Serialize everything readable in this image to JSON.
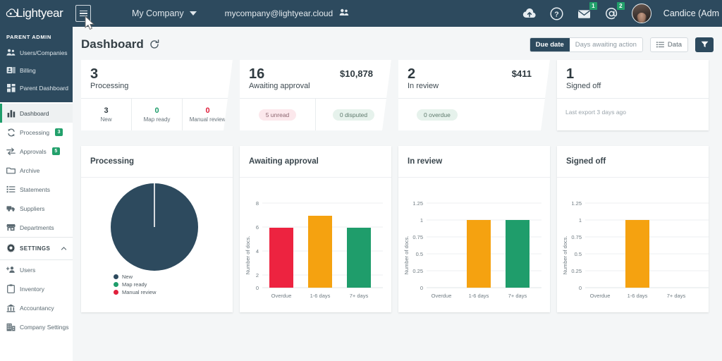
{
  "topbar": {
    "logo_text": "Lightyear",
    "logo_icon": "cloud-icon",
    "menu_toggle_icon": "hamburger-menu-icon",
    "company_selector": "My Company",
    "company_caret_icon": "chevron-down-icon",
    "tenant_domain": "mycompany@lightyear.cloud",
    "tenant_icon": "users-icon",
    "upload_icon": "cloud-upload-icon",
    "help_icon": "question-mark-icon",
    "mail_icon": "envelope-icon",
    "mail_badge": "1",
    "mentions_icon": "at-sign-icon",
    "mentions_badge": "2",
    "avatar_icon": "user-avatar",
    "user_name": "Candice (Adm"
  },
  "sidebar": {
    "section_title": "PARENT ADMIN",
    "admin_items": [
      {
        "label": "Users/Companies",
        "icon": "users-group-icon"
      },
      {
        "label": "Billing",
        "icon": "billing-card-icon"
      },
      {
        "label": "Parent Dashboard",
        "icon": "grid-dashboard-icon"
      }
    ],
    "main_items": [
      {
        "label": "Dashboard",
        "icon": "bar-chart-icon",
        "active": true,
        "badge": ""
      },
      {
        "label": "Processing",
        "icon": "refresh-cycle-icon",
        "active": false,
        "badge": "3"
      },
      {
        "label": "Approvals",
        "icon": "arrows-exchange-icon",
        "active": false,
        "badge": "5"
      },
      {
        "label": "Archive",
        "icon": "folder-icon",
        "active": false,
        "badge": ""
      },
      {
        "label": "Statements",
        "icon": "list-icon",
        "active": false,
        "badge": ""
      },
      {
        "label": "Suppliers",
        "icon": "truck-icon",
        "active": false,
        "badge": ""
      },
      {
        "label": "Departments",
        "icon": "store-icon",
        "active": false,
        "badge": ""
      }
    ],
    "settings_label": "SETTINGS",
    "settings_icon": "gear-icon",
    "settings_chevron_icon": "chevron-up-icon",
    "settings_items": [
      {
        "label": "Users",
        "icon": "add-user-icon"
      },
      {
        "label": "Inventory",
        "icon": "clipboard-icon"
      },
      {
        "label": "Accountancy",
        "icon": "bank-icon"
      },
      {
        "label": "Company Settings",
        "icon": "building-settings-icon"
      }
    ]
  },
  "page": {
    "title": "Dashboard",
    "refresh_icon": "refresh-icon",
    "segmented": [
      {
        "label": "Due date",
        "selected": true
      },
      {
        "label": "Days awaiting action",
        "selected": false
      }
    ],
    "data_button": {
      "label": "Data",
      "icon": "list-view-icon"
    },
    "filter_button_icon": "filter-icon"
  },
  "stat_cards": [
    {
      "count": "3",
      "label": "Processing",
      "amount": "",
      "cells": [
        {
          "num": "3",
          "label": "New",
          "color": "#2f3a40"
        },
        {
          "num": "0",
          "label": "Map ready",
          "color": "#1f9d6b"
        },
        {
          "num": "0",
          "label": "Manual review",
          "color": "#e0203c"
        }
      ],
      "chips": [],
      "note": ""
    },
    {
      "count": "16",
      "label": "Awaiting approval",
      "amount": "$10,878",
      "cells": [],
      "chips": [
        {
          "label": "5 unread",
          "style": "pink"
        },
        {
          "label": "0 disputed",
          "style": "green"
        }
      ],
      "note": ""
    },
    {
      "count": "2",
      "label": "In review",
      "amount": "$411",
      "cells": [],
      "chips": [
        {
          "label": "0 overdue",
          "style": "green"
        }
      ],
      "note": ""
    },
    {
      "count": "1",
      "label": "Signed off",
      "amount": "",
      "cells": [],
      "chips": [],
      "note": "Last export 3 days ago"
    }
  ],
  "chart_data": [
    {
      "type": "pie",
      "title": "Processing",
      "labels": [
        "New",
        "Map ready",
        "Manual review"
      ],
      "values": [
        3,
        0,
        0
      ],
      "colors": [
        "#2d4a5e",
        "#1f9d6b",
        "#e0203c"
      ],
      "legend": "bottom"
    },
    {
      "type": "bar",
      "title": "Awaiting approval",
      "categories": [
        "Overdue",
        "1-6 days",
        "7+ days"
      ],
      "values": [
        5,
        6,
        5
      ],
      "colors": [
        "#ed2340",
        "#f5a210",
        "#1f9d6b"
      ],
      "ylabel": "Number of docs.",
      "xlabel": "",
      "ylim": [
        0,
        8
      ],
      "yticks": [
        "0",
        "2",
        "4",
        "6",
        "8"
      ],
      "grid": true
    },
    {
      "type": "bar",
      "title": "In review",
      "categories": [
        "Overdue",
        "1-6 days",
        "7+ days"
      ],
      "values": [
        0,
        1,
        1
      ],
      "colors": [
        "#ed2340",
        "#f5a210",
        "#1f9d6b"
      ],
      "ylabel": "Number of docs.",
      "xlabel": "",
      "ylim": [
        0,
        1.25
      ],
      "yticks": [
        "0",
        "0.25",
        "0.5",
        "0.75",
        "1",
        "1.25"
      ],
      "grid": true
    },
    {
      "type": "bar",
      "title": "Signed off",
      "categories": [
        "Overdue",
        "1-6 days",
        "7+ days"
      ],
      "values": [
        0,
        1,
        0
      ],
      "colors": [
        "#ed2340",
        "#f5a210",
        "#1f9d6b"
      ],
      "ylabel": "Number of docs.",
      "xlabel": "",
      "ylim": [
        0,
        1.25
      ],
      "yticks": [
        "0",
        "0.25",
        "0.5",
        "0.75",
        "1",
        "1.25"
      ],
      "grid": true
    }
  ]
}
